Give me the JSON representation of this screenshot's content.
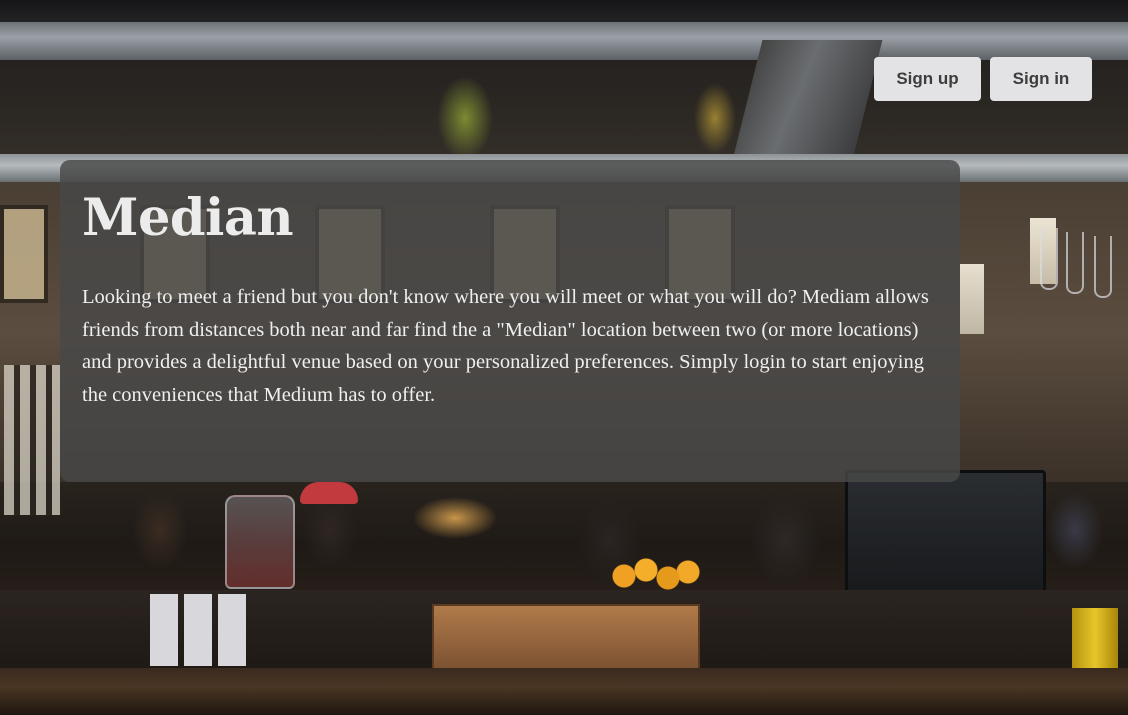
{
  "header": {
    "sign_up_label": "Sign up",
    "sign_in_label": "Sign in"
  },
  "hero": {
    "title": "Median",
    "description": "Looking to meet a friend but you don't know where you will meet or what you will do? Mediam allows friends from distances both near and far find the a \"Median\" location between two (or more locations) and provides a delightful venue based on your personalized preferences. Simply login to start enjoying the conveniences that Medium has to offer."
  },
  "colors": {
    "button_bg": "#e3e3e5",
    "button_text": "#3d3d3d",
    "card_bg": "#484848",
    "card_text": "#efefef"
  }
}
